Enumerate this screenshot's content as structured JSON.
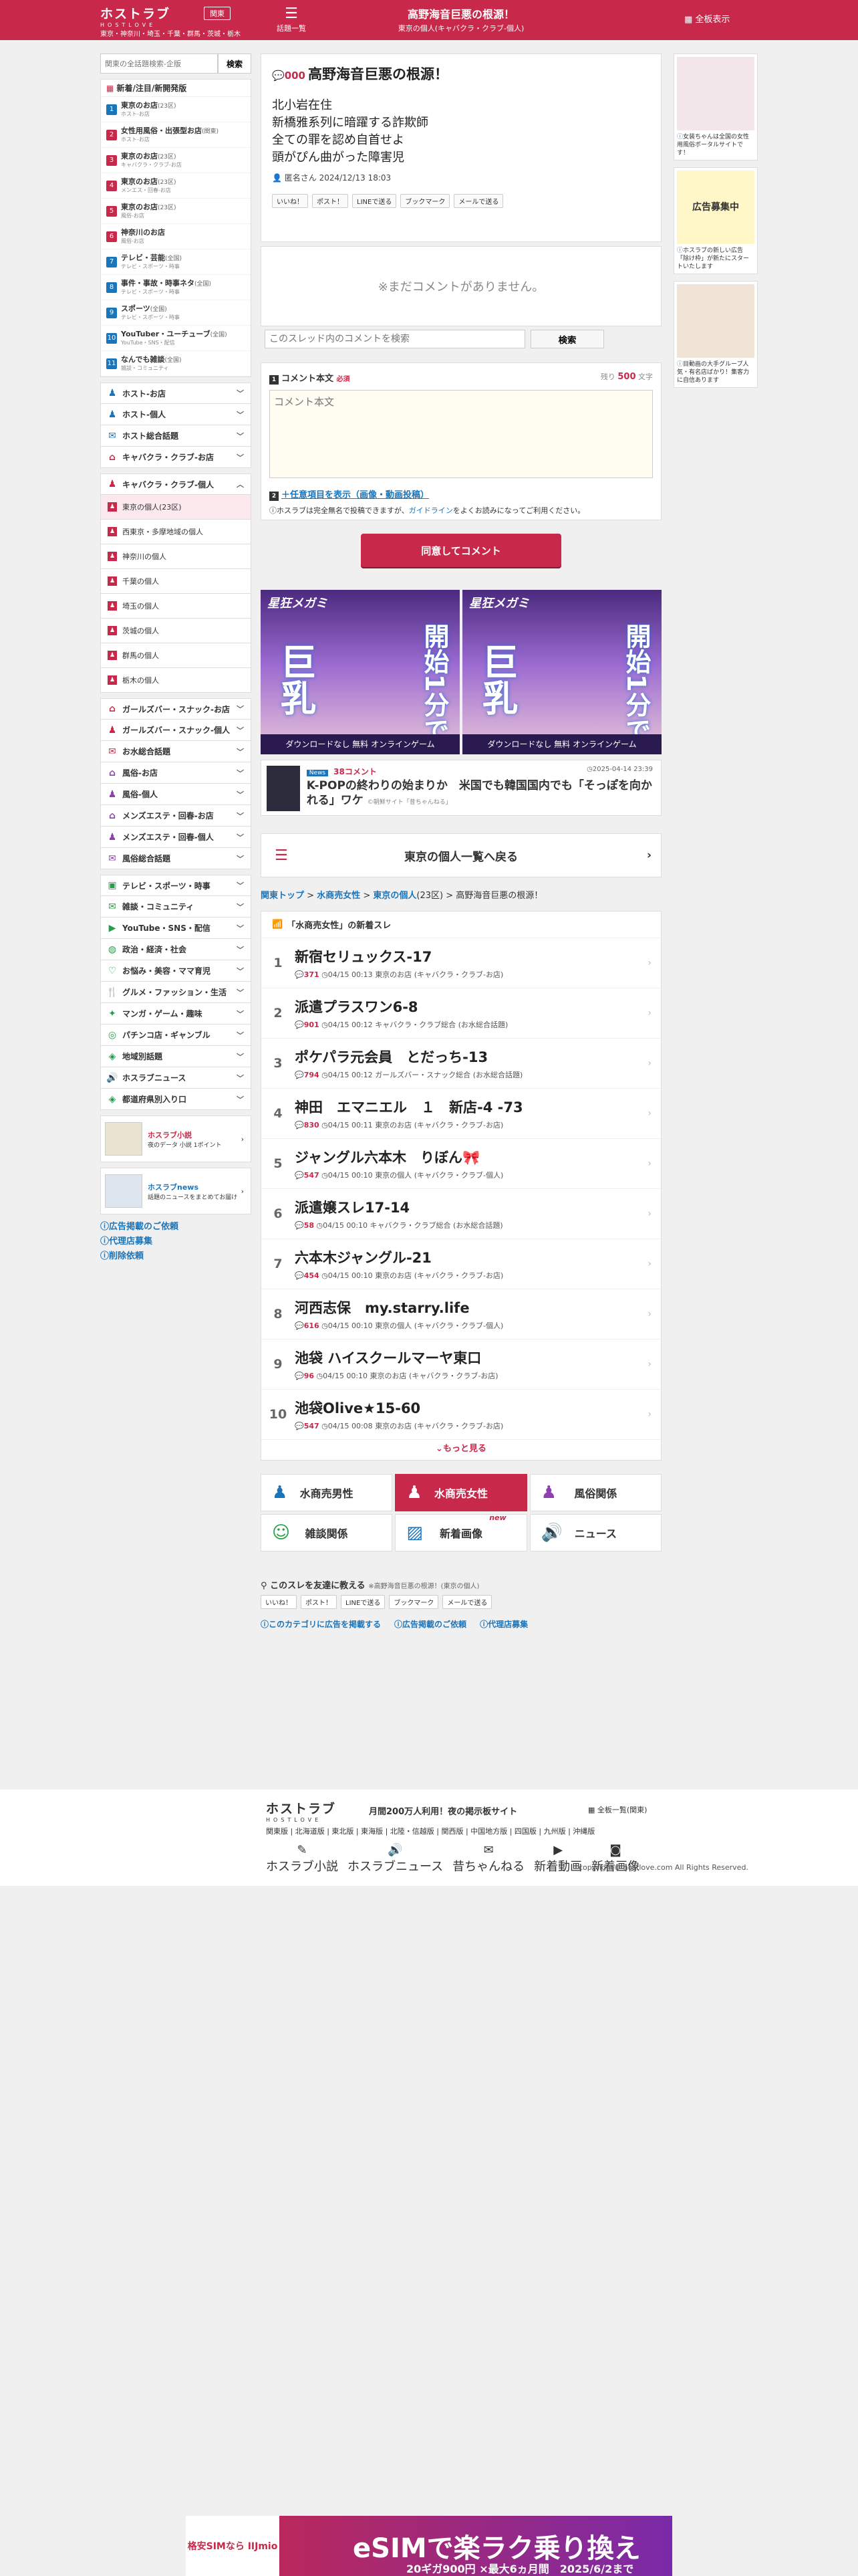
{
  "header": {
    "logo": "ホストラブ",
    "logo_sub": "HOSTLOVE",
    "region": "関東",
    "areas": "東京・神奈川・埼玉・千葉・群馬・茨城・栃木",
    "list_label": "話題一覧",
    "list_icon": "list-icon",
    "title": "高野海音巨悪の根源！",
    "subtitle": "東京の個人(キャバクラ・クラブ-個人)",
    "full_label": "全板表示"
  },
  "sidebar": {
    "search_placeholder": "関東の全話題検索-企版",
    "search_button": "検索",
    "new_boards_title": "新着/注目/新開発版",
    "boards": [
      {
        "n": "1",
        "title": "東京のお店",
        "area": "(23区)",
        "sub": "ホスト-お店",
        "color": "#1b75bb"
      },
      {
        "n": "2",
        "title": "女性用風俗・出張型お店",
        "area": "(関東)",
        "sub": "ホスト-お店",
        "color": "#c8284a"
      },
      {
        "n": "3",
        "title": "東京のお店",
        "area": "(23区)",
        "sub": "キャバクラ・クラブ-お店",
        "color": "#c8284a"
      },
      {
        "n": "4",
        "title": "東京のお店",
        "area": "(23区)",
        "sub": "メンエス・回春-お店",
        "color": "#c8284a"
      },
      {
        "n": "5",
        "title": "東京のお店",
        "area": "(23区)",
        "sub": "風俗-お店",
        "color": "#c8284a"
      },
      {
        "n": "6",
        "title": "神奈川のお店",
        "area": "",
        "sub": "風俗-お店",
        "color": "#c8284a"
      },
      {
        "n": "7",
        "title": "テレビ・芸能",
        "area": "(全国)",
        "sub": "テレビ・スポーツ・時事",
        "color": "#1b75bb"
      },
      {
        "n": "8",
        "title": "事件・事故・時事ネタ",
        "area": "(全国)",
        "sub": "テレビ・スポーツ・時事",
        "color": "#1b75bb"
      },
      {
        "n": "9",
        "title": "スポーツ",
        "area": "(全国)",
        "sub": "テレビ・スポーツ・時事",
        "color": "#1b75bb"
      },
      {
        "n": "10",
        "title": "YouTuber・ユーチューブ",
        "area": "(全国)",
        "sub": "YouTube・SNS・配信",
        "color": "#1b75bb"
      },
      {
        "n": "11",
        "title": "なんでも雑談",
        "area": "(全国)",
        "sub": "雑談・コミュニティ",
        "color": "#1b75bb"
      }
    ],
    "cats_a": [
      {
        "label": "ホスト-お店",
        "icon": "person-icon",
        "color": "#1b75bb"
      },
      {
        "label": "ホスト-個人",
        "icon": "person-icon",
        "color": "#1b75bb"
      },
      {
        "label": "ホスト総合話題",
        "icon": "chat-icon",
        "color": "#1b75bb"
      },
      {
        "label": "キャバクラ・クラブ-お店",
        "icon": "house-icon",
        "color": "#c8284a"
      }
    ],
    "cat_open": {
      "label": "キャバクラ・クラブ-個人",
      "icon": "person-icon",
      "color": "#c8284a"
    },
    "subs": [
      "東京の個人(23区)",
      "西東京・多摩地域の個人",
      "神奈川の個人",
      "千葉の個人",
      "埼玉の個人",
      "茨城の個人",
      "群馬の個人",
      "栃木の個人"
    ],
    "cats_b": [
      {
        "label": "ガールズバー・スナック-お店",
        "icon": "house-icon",
        "color": "#c8284a"
      },
      {
        "label": "ガールズバー・スナック-個人",
        "icon": "person-icon",
        "color": "#c8284a"
      },
      {
        "label": "お水総合話題",
        "icon": "chat-icon",
        "color": "#c8284a"
      },
      {
        "label": "風俗-お店",
        "icon": "house-icon",
        "color": "#8e3fb0"
      },
      {
        "label": "風俗-個人",
        "icon": "person-icon",
        "color": "#8e3fb0"
      },
      {
        "label": "メンズエステ・回春-お店",
        "icon": "house-icon",
        "color": "#8e3fb0"
      },
      {
        "label": "メンズエステ・回春-個人",
        "icon": "person-icon",
        "color": "#8e3fb0"
      },
      {
        "label": "風俗総合話題",
        "icon": "chat-icon",
        "color": "#8e3fb0"
      }
    ],
    "cats_c": [
      {
        "label": "テレビ・スポーツ・時事",
        "icon": "tv-icon",
        "color": "#2a9d4a"
      },
      {
        "label": "雑談・コミュニティ",
        "icon": "chat-icon",
        "color": "#2a9d4a"
      },
      {
        "label": "YouTube・SNS・配信",
        "icon": "play-icon",
        "color": "#2a9d4a"
      },
      {
        "label": "政治・経済・社会",
        "icon": "globe-icon",
        "color": "#2a9d4a"
      },
      {
        "label": "お悩み・美容・ママ育児",
        "icon": "heart-icon",
        "color": "#2a9d4a"
      },
      {
        "label": "グルメ・ファッション・生活",
        "icon": "food-icon",
        "color": "#2a9d4a"
      },
      {
        "label": "マンガ・ゲーム・趣味",
        "icon": "game-icon",
        "color": "#2a9d4a"
      },
      {
        "label": "パチンコ店・ギャンブル",
        "icon": "pachinko-icon",
        "color": "#2a9d4a"
      },
      {
        "label": "地域別話題",
        "icon": "map-icon",
        "color": "#2a9d4a"
      },
      {
        "label": "ホスラブニュース",
        "icon": "speaker-icon",
        "color": "#2a9d4a"
      },
      {
        "label": "都道府県別入り口",
        "icon": "map-icon",
        "color": "#2a9d4a"
      }
    ],
    "ad1": "夜のデータ 小説 1ポイント",
    "ad1_title": "ホスラブ小説",
    "ad2_title": "ホスラブnews",
    "ad2": "話題のニュースをまとめてお届け",
    "links": [
      "広告掲載のご依頼",
      "代理店募集",
      "削除依頼"
    ]
  },
  "post": {
    "no": "000",
    "title": "高野海音巨悪の根源！",
    "lines": [
      "北小岩在住",
      "新橋雅系列に暗躍する詐欺師",
      "全ての罪を認め自首せよ",
      "頭がぴん曲がった障害児"
    ],
    "meta": "匿名さん 2024/12/13 18:03",
    "share": [
      "いいね！",
      "ポスト！",
      "LINEで送る",
      "ブックマーク",
      "メールで送る"
    ]
  },
  "no_comment": "※まだコメントがありません。",
  "thread_search": {
    "placeholder": "このスレッド内のコメントを検索",
    "button": "検索"
  },
  "form": {
    "label": "コメント本文",
    "required": "必須",
    "count_prefix": "残り",
    "count": "500",
    "count_suffix": "文字",
    "placeholder": "コメント本文",
    "option": "＋任意項目を表示（画像・動画投稿）",
    "note_a": "ホスラブは完全無名で投稿できますが、",
    "note_link": "ガイドライン",
    "note_b": "をよくお読みになってご利用ください。",
    "submit": "同意してコメント"
  },
  "banner": {
    "brand": "星狂メガミ",
    "big": "巨乳",
    "start": "開始1分で",
    "foot": "ダウンロードなし 無料 オンラインゲーム"
  },
  "news": {
    "tag": "News",
    "comments": "38コメント",
    "date": "2025-04-14 23:39",
    "title": "K-POPの終わりの始まりか　米国でも韓国国内でも「そっぽを向かれる」ワケ",
    "source": "©朝鮮サイト「昔ちゃんねる」"
  },
  "back_label": "東京の個人一覧へ戻る",
  "breadcrumb": {
    "a": "関東トップ",
    "b": "水商売女性",
    "c": "東京の個人",
    "c_area": "(23区)",
    "d": "高野海音巨悪の根源！"
  },
  "newlist": {
    "title": "「水商売女性」の新着スレ",
    "more": "もっと見る",
    "rows": [
      {
        "rank": "1",
        "title": "新宿セリュックス-17",
        "count": "371",
        "time": "04/15 00:13",
        "board": "東京のお店",
        "cat": "(キャバクラ・クラブ-お店)"
      },
      {
        "rank": "2",
        "title": "派遣プラスワン6-8",
        "count": "901",
        "time": "04/15 00:12",
        "board": "キャバクラ・クラブ総合",
        "cat": "(お水総合話題)"
      },
      {
        "rank": "3",
        "title": "ポケパラ元会員　とだっち-13",
        "count": "794",
        "time": "04/15 00:12",
        "board": "ガールズバー・スナック総合",
        "cat": "(お水総合話題)"
      },
      {
        "rank": "4",
        "title": "神田　エマニエル　１　新店-4 -73",
        "count": "830",
        "time": "04/15 00:11",
        "board": "東京のお店",
        "cat": "(キャバクラ・クラブ-お店)"
      },
      {
        "rank": "5",
        "title": "ジャングル六本木　りぼん🎀",
        "count": "547",
        "time": "04/15 00:10",
        "board": "東京の個人",
        "cat": "(キャバクラ・クラブ-個人)"
      },
      {
        "rank": "6",
        "title": "派遣嬢スレ17-14",
        "count": "58",
        "time": "04/15 00:10",
        "board": "キャバクラ・クラブ総合",
        "cat": "(お水総合話題)"
      },
      {
        "rank": "7",
        "title": "六本木ジャングル-21",
        "count": "454",
        "time": "04/15 00:10",
        "board": "東京のお店",
        "cat": "(キャバクラ・クラブ-お店)"
      },
      {
        "rank": "8",
        "title": "河西志保　my.starry.life",
        "count": "616",
        "time": "04/15 00:10",
        "board": "東京の個人",
        "cat": "(キャバクラ・クラブ-個人)"
      },
      {
        "rank": "9",
        "title": "池袋 ハイスクールマーヤ東口",
        "count": "96",
        "time": "04/15 00:10",
        "board": "東京のお店",
        "cat": "(キャバクラ・クラブ-お店)"
      },
      {
        "rank": "10",
        "title": "池袋Olive★15-60",
        "count": "547",
        "time": "04/15 00:08",
        "board": "東京のお店",
        "cat": "(キャバクラ・クラブ-お店)"
      }
    ]
  },
  "catgrid": [
    {
      "label": "水商売男性",
      "icon": "person-icon",
      "on": false,
      "color": "#1b75bb"
    },
    {
      "label": "水商売女性",
      "icon": "person-icon",
      "on": true,
      "color": "#fff"
    },
    {
      "label": "風俗関係",
      "icon": "person-icon",
      "on": false,
      "color": "#8e3fb0"
    },
    {
      "label": "雑談関係",
      "icon": "smile-icon",
      "on": false,
      "color": "#2a9d4a"
    },
    {
      "label": "新着画像",
      "icon": "image-icon",
      "on": false,
      "color": "#1b75bb",
      "new": "new"
    },
    {
      "label": "ニュース",
      "icon": "speaker-icon",
      "on": false,
      "color": "#333"
    }
  ],
  "friends": {
    "title": "このスレを友達に教える",
    "sub": "※高野海音巨悪の根源！(東京の個人)",
    "share": [
      "いいね！",
      "ポスト！",
      "LINEで送る",
      "ブックマーク",
      "メールで送る"
    ]
  },
  "adlinks": [
    "このカテゴリに広告を掲載する",
    "広告掲載のご依頼",
    "代理店募集"
  ],
  "right_ads": [
    {
      "text": "女装ちゃんは全国の女性用風俗ポータルサイトです！",
      "bg": "#f3e6ea"
    },
    {
      "text": "ホスラブの新しい広告「除け枠」が新たにスタートいたします",
      "bg": "#fff7c8",
      "head": "広告募集中"
    },
    {
      "text": "目動画の大手グループ人気・有名店ばかり！集客力に自信あります",
      "bg": "#efe4d6"
    }
  ],
  "footer": {
    "logo": "ホストラブ",
    "logo_sub": "HOSTLOVE",
    "tag": "月間200万人利用！夜の掲示板サイト",
    "all": "全板一覧(関東)",
    "regions": "関東版 | 北海道版 | 東北版 | 東海版 | 北陸・信越版 | 関西版 | 中国地方版 | 四国版 | 九州版 | 沖縄版",
    "icons": [
      "ホスラブ小説",
      "ホスラブニュース",
      "昔ちゃんねる",
      "新着動画",
      "新着画像"
    ],
    "copyright": "copyright© hostlove.com All Rights Reserved."
  },
  "bottom_ad": {
    "brand": "格安SIMなら IIJmio",
    "main": "eSIMで楽ラク乗り換え",
    "sub": "20ギガ900円 ×最大6ヵ月間　2025/6/2まで"
  }
}
